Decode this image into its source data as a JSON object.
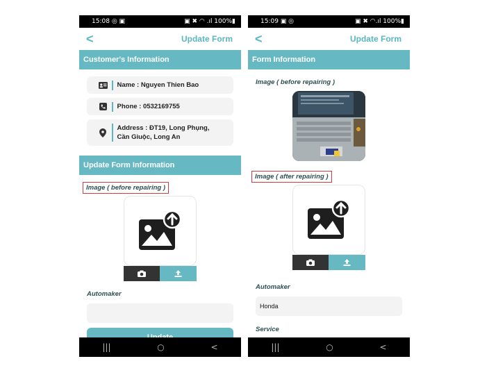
{
  "colors": {
    "accent": "#66b9c2",
    "highlight_border": "#d23b3b",
    "dark_button": "#333333"
  },
  "left": {
    "status": {
      "time": "15:08",
      "icons_left": "◎ ▣",
      "icons_right": "▣ ✖ ◠ .ıl 100%▮"
    },
    "appbar": {
      "back": "<",
      "title": "Update Form"
    },
    "customer_section": "Customer's Information",
    "customer": {
      "name": "Name : Nguyen Thien Bao",
      "phone": "Phone : 0532169755",
      "address": "Address : ĐT19, Long Phụng, Cần Giuộc, Long An"
    },
    "update_section": "Update Form Information",
    "image_before_label": "Image ( before repairing )",
    "automaker_label": "Automaker",
    "automaker_value": "",
    "update_button": "Update",
    "nav": {
      "recents": "|||",
      "home": "○",
      "back": "<"
    }
  },
  "right": {
    "status": {
      "time": "15:09",
      "icons_left": "▣ ◎",
      "icons_right": "▣ ✖ ◠.ıl 100%▮"
    },
    "appbar": {
      "back": "<",
      "title": "Update Form"
    },
    "form_section": "Form Information",
    "image_before_label": "Image ( before repairing )",
    "image_after_label": "Image ( after repairing )",
    "automaker_label": "Automaker",
    "automaker_value": "Honda",
    "service_label": "Service",
    "nav": {
      "recents": "|||",
      "home": "○",
      "back": "<"
    }
  }
}
